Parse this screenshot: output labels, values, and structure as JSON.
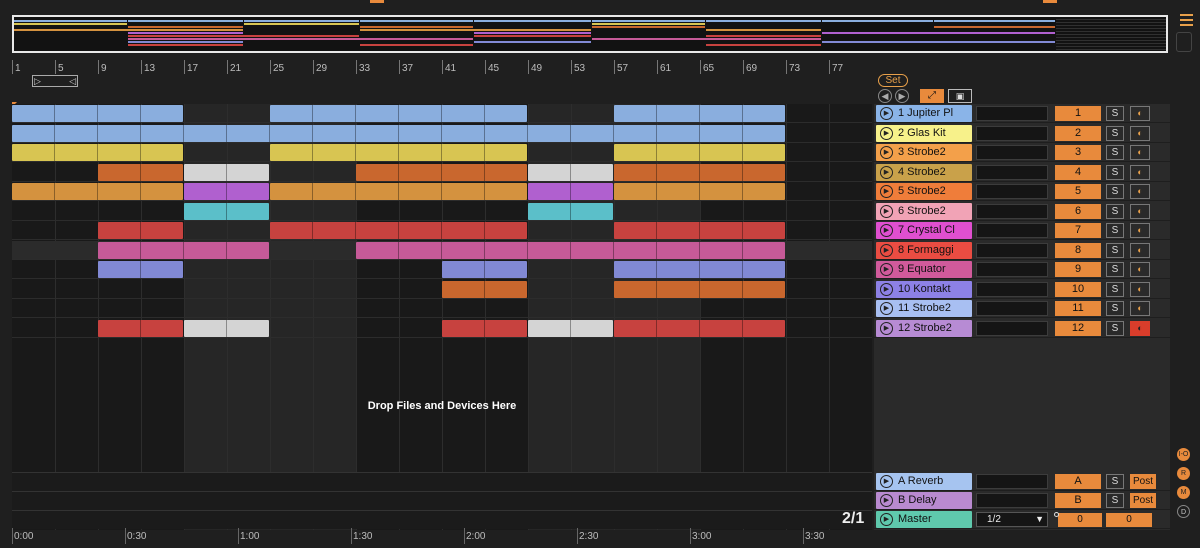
{
  "colors": {
    "accent": "#e88a3c",
    "blue": "#8aaede",
    "yellow": "#d8c552",
    "orange": "#c9672e",
    "amber": "#d4923f",
    "white": "#d4d4d4",
    "purple": "#b060cf",
    "cyan": "#5bbfc9",
    "red": "#c7423f",
    "pink": "#c65a98",
    "violet": "#8189d4"
  },
  "ruler": {
    "bars": [
      "1",
      "5",
      "9",
      "13",
      "17",
      "21",
      "25",
      "29",
      "33",
      "37",
      "41",
      "45",
      "49",
      "53",
      "57",
      "61",
      "65",
      "69",
      "73",
      "77"
    ]
  },
  "time_ruler": {
    "labels": [
      "0:00",
      "0:30",
      "1:00",
      "1:30",
      "2:00",
      "2:30",
      "3:00",
      "3:30"
    ]
  },
  "arrangement": {
    "drop_text": "Drop Files and Devices Here",
    "zoom": "2/1"
  },
  "controls": {
    "set_label": "Set",
    "back_icon": "arrow-left-icon",
    "fwd_icon": "arrow-right-icon",
    "fit_icon": "fit-icon",
    "lock_icon": "lock-icon"
  },
  "tracks": [
    {
      "name": "1 Jupiter Pl",
      "num": "1",
      "color": "#8ab4e8",
      "armed": false
    },
    {
      "name": "2 Glas Kit",
      "num": "2",
      "color": "#f7f18a",
      "armed": false
    },
    {
      "name": "3 Strobe2",
      "num": "3",
      "color": "#f3a04a",
      "armed": false
    },
    {
      "name": "4 Strobe2",
      "num": "4",
      "color": "#c9a14a",
      "armed": false
    },
    {
      "name": "5 Strobe2",
      "num": "5",
      "color": "#ef7d3a",
      "armed": false
    },
    {
      "name": "6 Strobe2",
      "num": "6",
      "color": "#f1a3b6",
      "armed": false
    },
    {
      "name": "7 Crystal Cl",
      "num": "7",
      "color": "#e04fd0",
      "armed": false
    },
    {
      "name": "8 Formaggi",
      "num": "8",
      "color": "#ea4c42",
      "armed": false
    },
    {
      "name": "9 Equator",
      "num": "9",
      "color": "#d15a9b",
      "armed": false
    },
    {
      "name": "10 Kontakt",
      "num": "10",
      "color": "#8d81e6",
      "armed": false
    },
    {
      "name": "11 Strobe2",
      "num": "11",
      "color": "#a8bff2",
      "armed": false
    },
    {
      "name": "12 Strobe2",
      "num": "12",
      "color": "#b78bd4",
      "armed": true
    }
  ],
  "returns": [
    {
      "name": "A Reverb",
      "num": "A",
      "post": "Post",
      "color": "#a6c4f0"
    },
    {
      "name": "B Delay",
      "num": "B",
      "post": "Post",
      "color": "#b98ad0"
    }
  ],
  "master": {
    "name": "Master",
    "color": "#5fc9ad",
    "select": "1/2",
    "vol_a": "0",
    "vol_b": "0"
  },
  "side_buttons": [
    "I-O",
    "R",
    "M",
    "D"
  ],
  "solo_label": "S",
  "arm_icon": "arm-icon"
}
